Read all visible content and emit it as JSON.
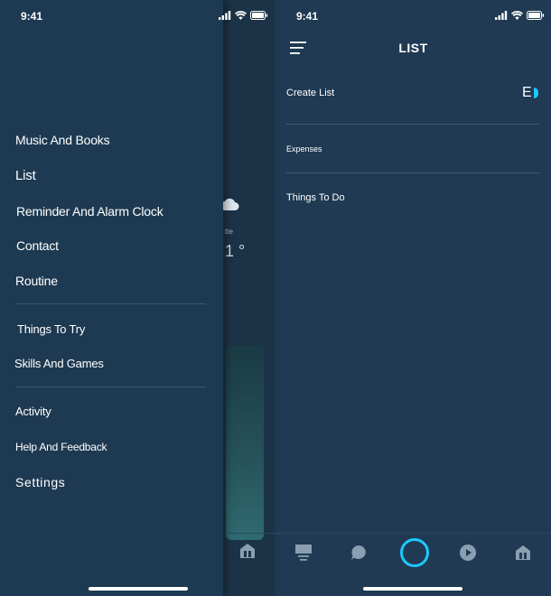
{
  "left_phone": {
    "status_time": "9:41",
    "drawer_items_group1": [
      "Music And Books",
      "List",
      "Reminder And Alarm Clock",
      "Contact",
      "Routine"
    ],
    "drawer_items_group2": [
      "Things To Try",
      "Skills And Games"
    ],
    "drawer_items_group3": [
      "Activity",
      "Help And Feedback",
      "Settings"
    ],
    "home_peek": {
      "weather_label": "tte",
      "temperature": "1 °"
    }
  },
  "right_phone": {
    "status_time": "9:41",
    "title": "LIST",
    "create_list_label": "Create List",
    "create_badge": "E",
    "lists": [
      "Expenses",
      "Things To Do"
    ]
  },
  "icons": {
    "menu": "hamburger-icon",
    "nav": [
      "home-icon",
      "chat-icon",
      "alexa-icon",
      "play-icon",
      "devices-icon"
    ]
  },
  "colors": {
    "background": "#1f3a52",
    "accent": "#1ec8ff",
    "separator": "#365a74"
  }
}
